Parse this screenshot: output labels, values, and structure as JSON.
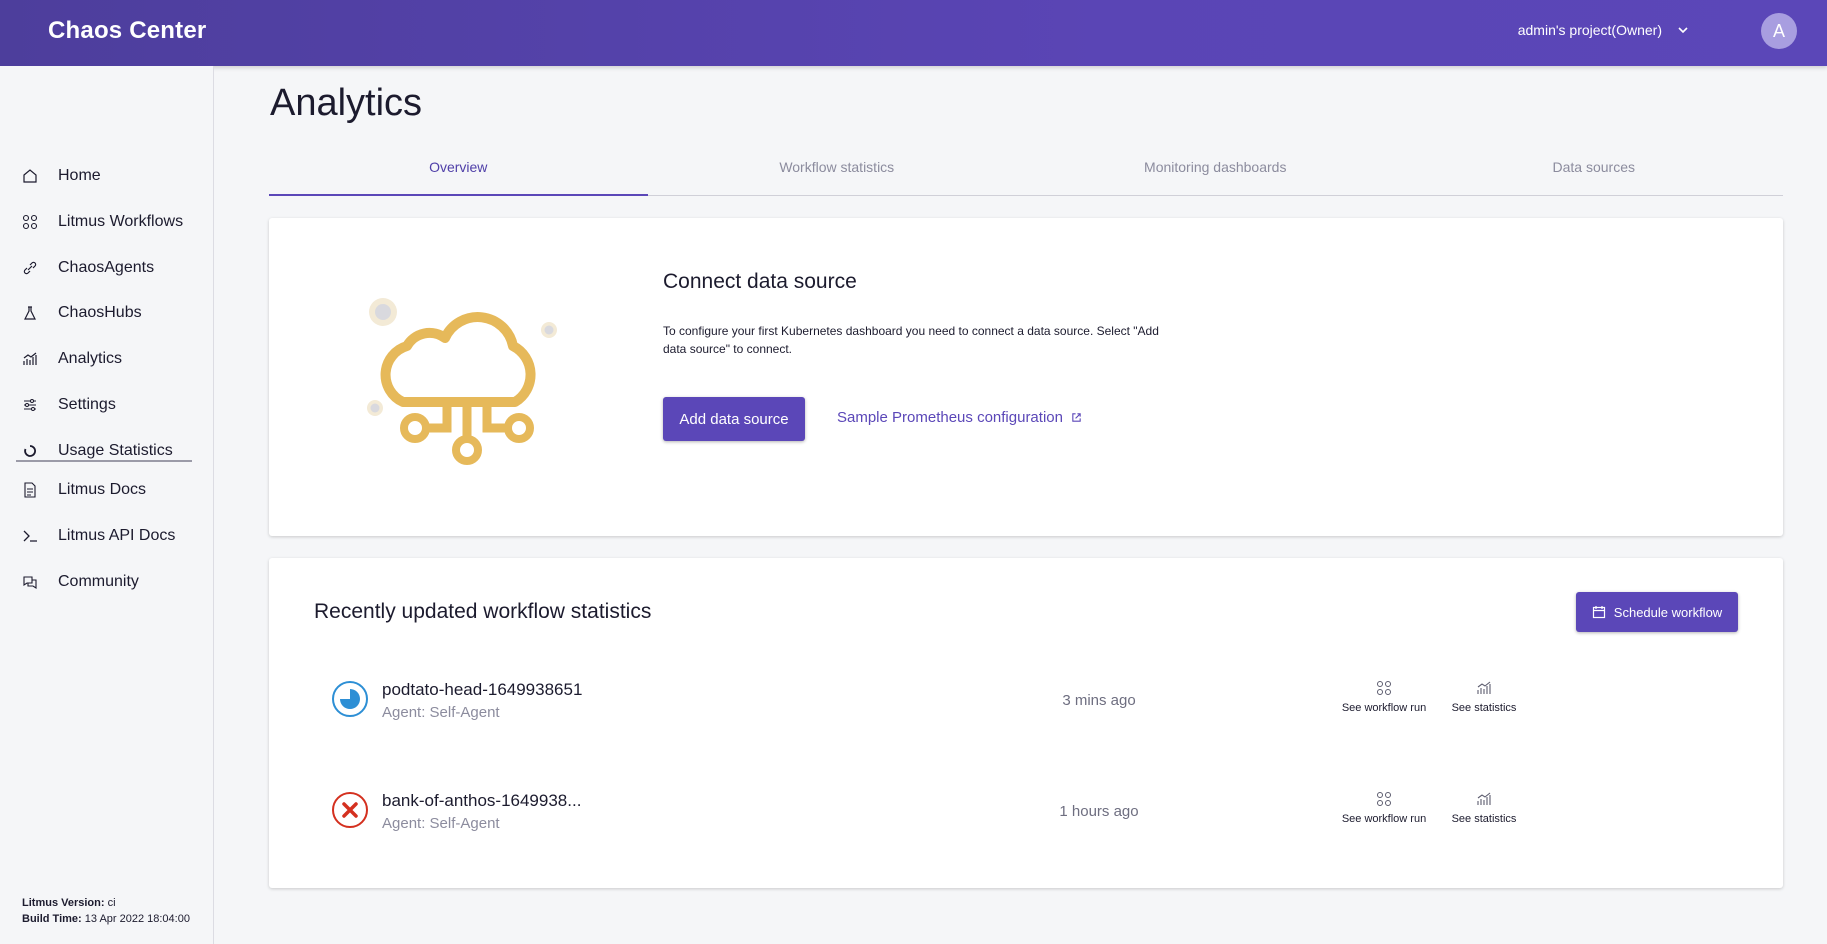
{
  "header": {
    "brand": "Chaos Center",
    "project": "admin's project(Owner)",
    "avatar_initial": "A"
  },
  "sidebar": {
    "items": [
      {
        "label": "Home",
        "icon": "home-icon"
      },
      {
        "label": "Litmus Workflows",
        "icon": "workflows-icon"
      },
      {
        "label": "ChaosAgents",
        "icon": "link-icon"
      },
      {
        "label": "ChaosHubs",
        "icon": "flask-icon"
      },
      {
        "label": "Analytics",
        "icon": "analytics-icon"
      },
      {
        "label": "Settings",
        "icon": "settings-icon"
      },
      {
        "label": "Usage Statistics",
        "icon": "circle-icon"
      }
    ],
    "links": [
      {
        "label": "Litmus Docs",
        "icon": "document-icon"
      },
      {
        "label": "Litmus API Docs",
        "icon": "terminal-icon"
      },
      {
        "label": "Community",
        "icon": "chat-icon"
      }
    ],
    "version_label": "Litmus Version:",
    "version_value": " ci",
    "build_label": "Build Time:",
    "build_value": " 13 Apr 2022 18:04:00"
  },
  "main": {
    "title": "Analytics",
    "tabs": [
      "Overview",
      "Workflow statistics",
      "Monitoring dashboards",
      "Data sources"
    ],
    "active_tab": "Overview",
    "connect": {
      "title": "Connect data source",
      "description": "To configure your first Kubernetes dashboard you need to connect a data source. Select \"Add data source\" to connect.",
      "button": "Add data source",
      "link": "Sample Prometheus configuration"
    },
    "recent": {
      "title": "Recently updated workflow statistics",
      "schedule_button": "Schedule workflow",
      "action_run": "See workflow run",
      "action_stats": "See statistics",
      "rows": [
        {
          "name": "podtato-head-1649938651",
          "agent": "Agent: Self-Agent",
          "time": "3 mins ago",
          "status": "running"
        },
        {
          "name": "bank-of-anthos-1649938...",
          "agent": "Agent: Self-Agent",
          "time": "1 hours ago",
          "status": "failed"
        }
      ]
    }
  },
  "colors": {
    "accent": "#5b47b8",
    "header_start": "#4d3e9c",
    "running": "#2d8fd5",
    "failed": "#d4301f",
    "illustration": "#e6b95a"
  }
}
